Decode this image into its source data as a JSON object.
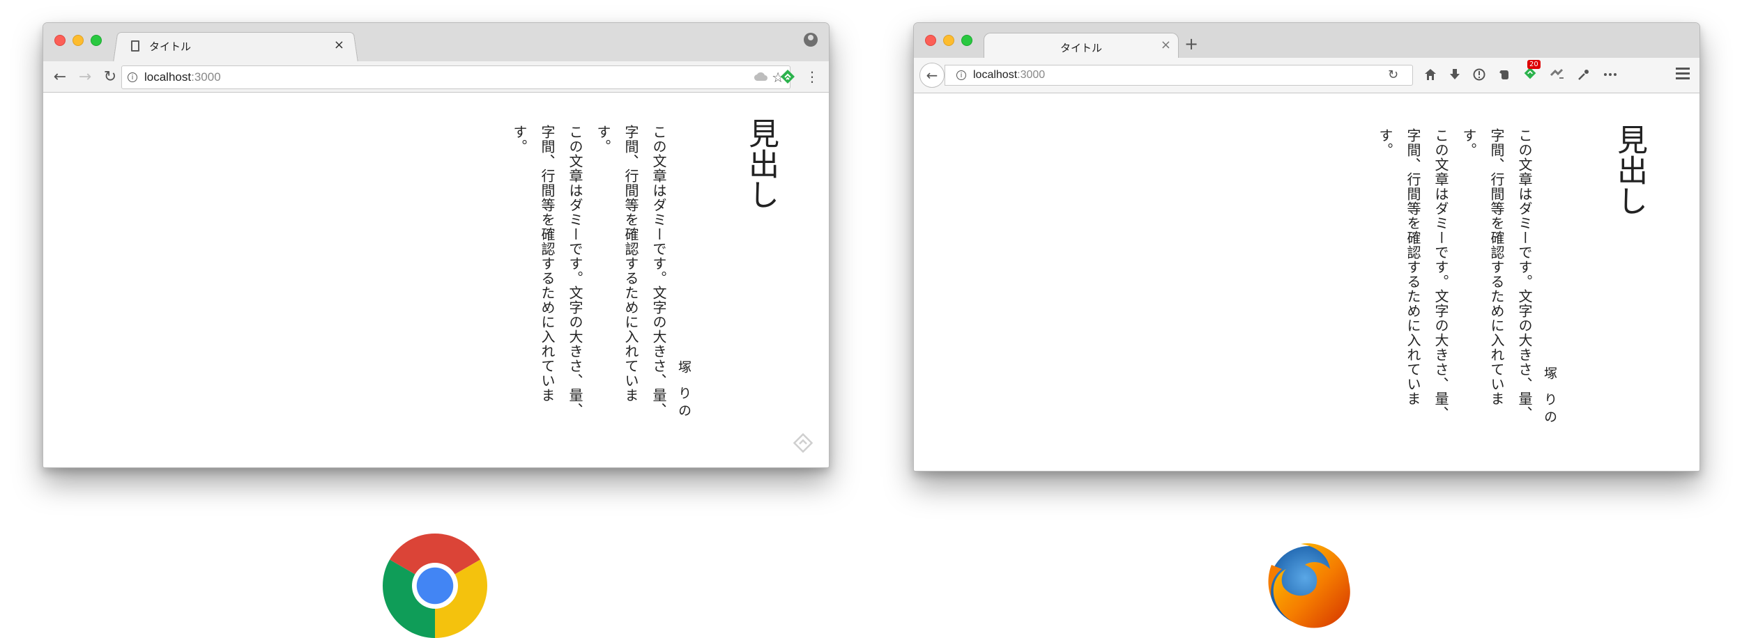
{
  "chrome": {
    "tab_title": "タイトル",
    "tab_close": "×",
    "back": "←",
    "forward": "→",
    "reload": "↻",
    "url_host": "localhost",
    "url_port": ":3000",
    "star": "☆",
    "menu": "⋮",
    "info": "i"
  },
  "firefox": {
    "tab_title": "タイトル",
    "tab_close": "×",
    "new_tab": "+",
    "back": "←",
    "url_host": "localhost",
    "url_port": ":3000",
    "reload": "↻",
    "info": "i",
    "badge_count": "20",
    "toolbar_icons": [
      "home-icon",
      "download-icon",
      "info-icon",
      "evernote-icon",
      "feedly-icon",
      "extension-icon",
      "eyedropper-icon",
      "more-icon",
      "menu-icon"
    ]
  },
  "page": {
    "heading": "見出し",
    "author": "塚 りの",
    "paragraph1": "この文章はダミーです。文字の大きさ、量、字間、行間等を確認するために入れています。",
    "paragraph2": "この文章はダミーです。文字の大きさ、量、字間、行間等を確認するために入れています。"
  },
  "colors": {
    "traffic_red": "#fc5f57",
    "traffic_yellow": "#fdbc2e",
    "traffic_green": "#29c840",
    "chrome_red": "#db4437",
    "chrome_yellow": "#f4c20d",
    "chrome_green": "#0f9d58",
    "chrome_blue": "#4285f4",
    "firefox_orange": "#e66000",
    "firefox_blue": "#0a4e9b"
  }
}
